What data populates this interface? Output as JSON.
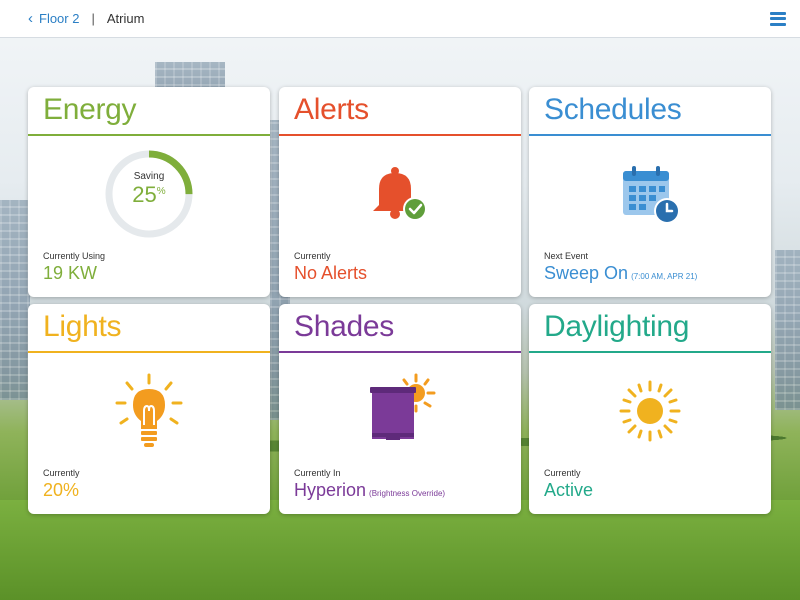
{
  "header": {
    "back_label": "Floor 2",
    "current": "Atrium"
  },
  "tiles": {
    "energy": {
      "title": "Energy",
      "ring_label": "Saving",
      "ring_value": "25",
      "ring_unit": "%",
      "ring_fraction": 0.25,
      "caption": "Currently Using",
      "value": "19 KW",
      "color": "#7fae3b"
    },
    "alerts": {
      "title": "Alerts",
      "icon": "bell-check-icon",
      "caption": "Currently",
      "value": "No Alerts",
      "color": "#e5502c"
    },
    "schedules": {
      "title": "Schedules",
      "icon": "calendar-clock-icon",
      "caption": "Next Event",
      "value": "Sweep On",
      "detail": "(7:00 AM, APR 21)",
      "color": "#3a8ed2"
    },
    "lights": {
      "title": "Lights",
      "icon": "lightbulb-icon",
      "caption": "Currently",
      "value": "20%",
      "color": "#f0b21f"
    },
    "shades": {
      "title": "Shades",
      "icon": "shade-sun-icon",
      "caption": "Currently In",
      "value": "Hyperion",
      "detail": "(Brightness Override)",
      "color": "#7b3a98"
    },
    "daylighting": {
      "title": "Daylighting",
      "icon": "sun-icon",
      "caption": "Currently",
      "value": "Active",
      "color": "#23a98a"
    }
  }
}
